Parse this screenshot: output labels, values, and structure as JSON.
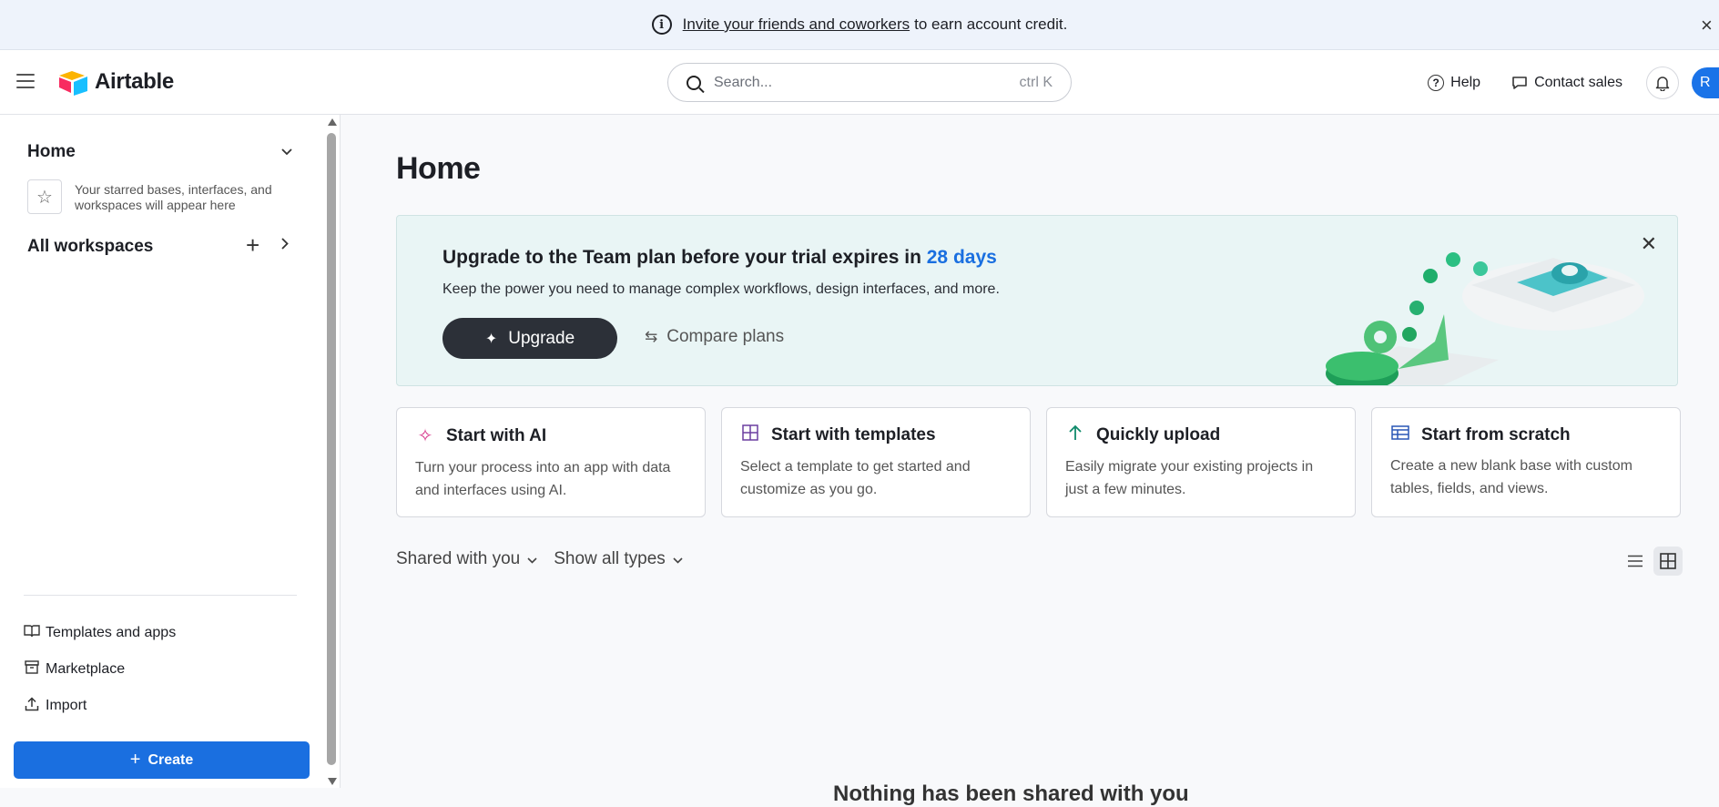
{
  "banner": {
    "link_text": "Invite your friends and coworkers",
    "text": "to earn account credit.",
    "close": "×"
  },
  "header": {
    "logo_text": "Airtable",
    "search_placeholder": "Search...",
    "search_shortcut": "ctrl K",
    "help_label": "Help",
    "contact_label": "Contact sales",
    "avatar_initial": "R"
  },
  "sidebar": {
    "home_label": "Home",
    "starred_hint": "Your starred bases, interfaces, and workspaces will appear here",
    "workspaces_label": "All workspaces",
    "links": [
      {
        "label": "Templates and apps",
        "icon": "book-icon"
      },
      {
        "label": "Marketplace",
        "icon": "store-icon"
      },
      {
        "label": "Import",
        "icon": "upload-icon"
      }
    ],
    "create_label": "Create"
  },
  "main": {
    "title": "Home",
    "promo": {
      "heading": "Upgrade to the Team plan before your trial expires in",
      "days": "28 days",
      "subtext": "Keep the power you need to manage complex workflows, design interfaces, and more.",
      "upgrade_label": "Upgrade",
      "compare_label": "Compare plans"
    },
    "cards": [
      {
        "title": "Start with AI",
        "desc": "Turn your process into an app with data and interfaces using AI.",
        "icon": "sparkle-icon",
        "color": "#d6338a"
      },
      {
        "title": "Start with templates",
        "desc": "Select a template to get started and customize as you go.",
        "icon": "grid-icon",
        "color": "#6b3fa0"
      },
      {
        "title": "Quickly upload",
        "desc": "Easily migrate your existing projects in just a few minutes.",
        "icon": "arrow-up-icon",
        "color": "#0f8a6b"
      },
      {
        "title": "Start from scratch",
        "desc": "Create a new blank base with custom tables, fields, and views.",
        "icon": "table-icon",
        "color": "#2856b6"
      }
    ],
    "filters": {
      "shared": "Shared with you",
      "types": "Show all types"
    },
    "empty_message": "Nothing has been shared with you"
  },
  "colors": {
    "accent": "#1a6fe0",
    "dark_button": "#2c3038",
    "promo_bg": "#e9f5f5"
  }
}
